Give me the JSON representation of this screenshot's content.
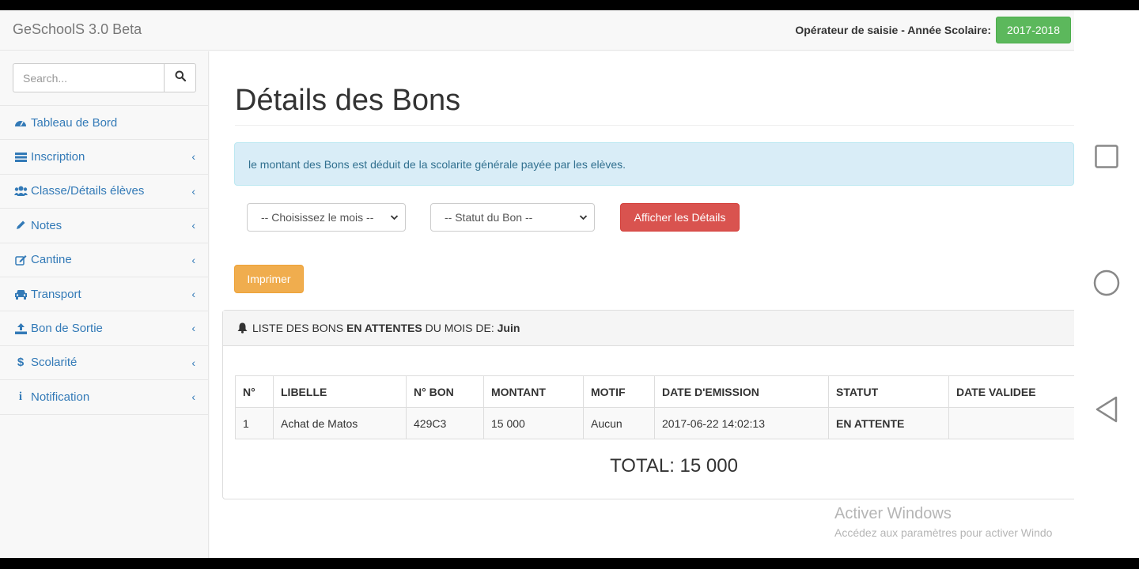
{
  "navbar": {
    "brand": "GeSchoolS 3.0 Beta",
    "role_text": "Opérateur de saisie - Année Scolaire:",
    "year": "2017-2018"
  },
  "sidebar": {
    "search_placeholder": "Search...",
    "items": [
      {
        "label": "Tableau de Bord",
        "icon": "dashboard-icon",
        "has_chevron": false
      },
      {
        "label": "Inscription",
        "icon": "list-icon",
        "has_chevron": true
      },
      {
        "label": "Classe/Détails élèves",
        "icon": "users-icon",
        "has_chevron": true
      },
      {
        "label": "Notes",
        "icon": "pencil-icon",
        "has_chevron": true
      },
      {
        "label": "Cantine",
        "icon": "edit-icon",
        "has_chevron": true
      },
      {
        "label": "Transport",
        "icon": "car-icon",
        "has_chevron": true
      },
      {
        "label": "Bon de Sortie",
        "icon": "upload-icon",
        "has_chevron": true
      },
      {
        "label": "Scolarité",
        "icon": "dollar-icon",
        "has_chevron": true
      },
      {
        "label": "Notification",
        "icon": "info-icon",
        "has_chevron": true
      }
    ]
  },
  "main": {
    "title": "Détails des Bons",
    "alert": "le montant des Bons est déduit de la scolarite générale payée par les elèves.",
    "select_month": "-- Choisissez le mois --",
    "select_status": "-- Statut du Bon --",
    "show_button": "Afficher les Détails",
    "print_button": "Imprimer",
    "panel": {
      "prefix": "LISTE DES BONS",
      "status": "EN ATTENTES",
      "middle": "DU MOIS DE:",
      "month": "Juin"
    },
    "table": {
      "headers": [
        "N°",
        "LIBELLE",
        "N° BON",
        "MONTANT",
        "MOTIF",
        "DATE D'EMISSION",
        "STATUT",
        "DATE VALIDEE"
      ],
      "rows": [
        [
          "1",
          "Achat de Matos",
          "429C3",
          "15 000",
          "Aucun",
          "2017-06-22 14:02:13",
          "EN ATTENTE",
          ""
        ]
      ]
    },
    "total": "TOTAL: 15 000"
  },
  "watermark": {
    "line1": "Activer Windows",
    "line2": "Accédez aux paramètres pour activer Windo"
  },
  "colors": {
    "success": "#5cb85c",
    "danger": "#d9534f",
    "warning": "#f0ad4e",
    "link": "#337ab7",
    "info_bg": "#d9edf7"
  }
}
